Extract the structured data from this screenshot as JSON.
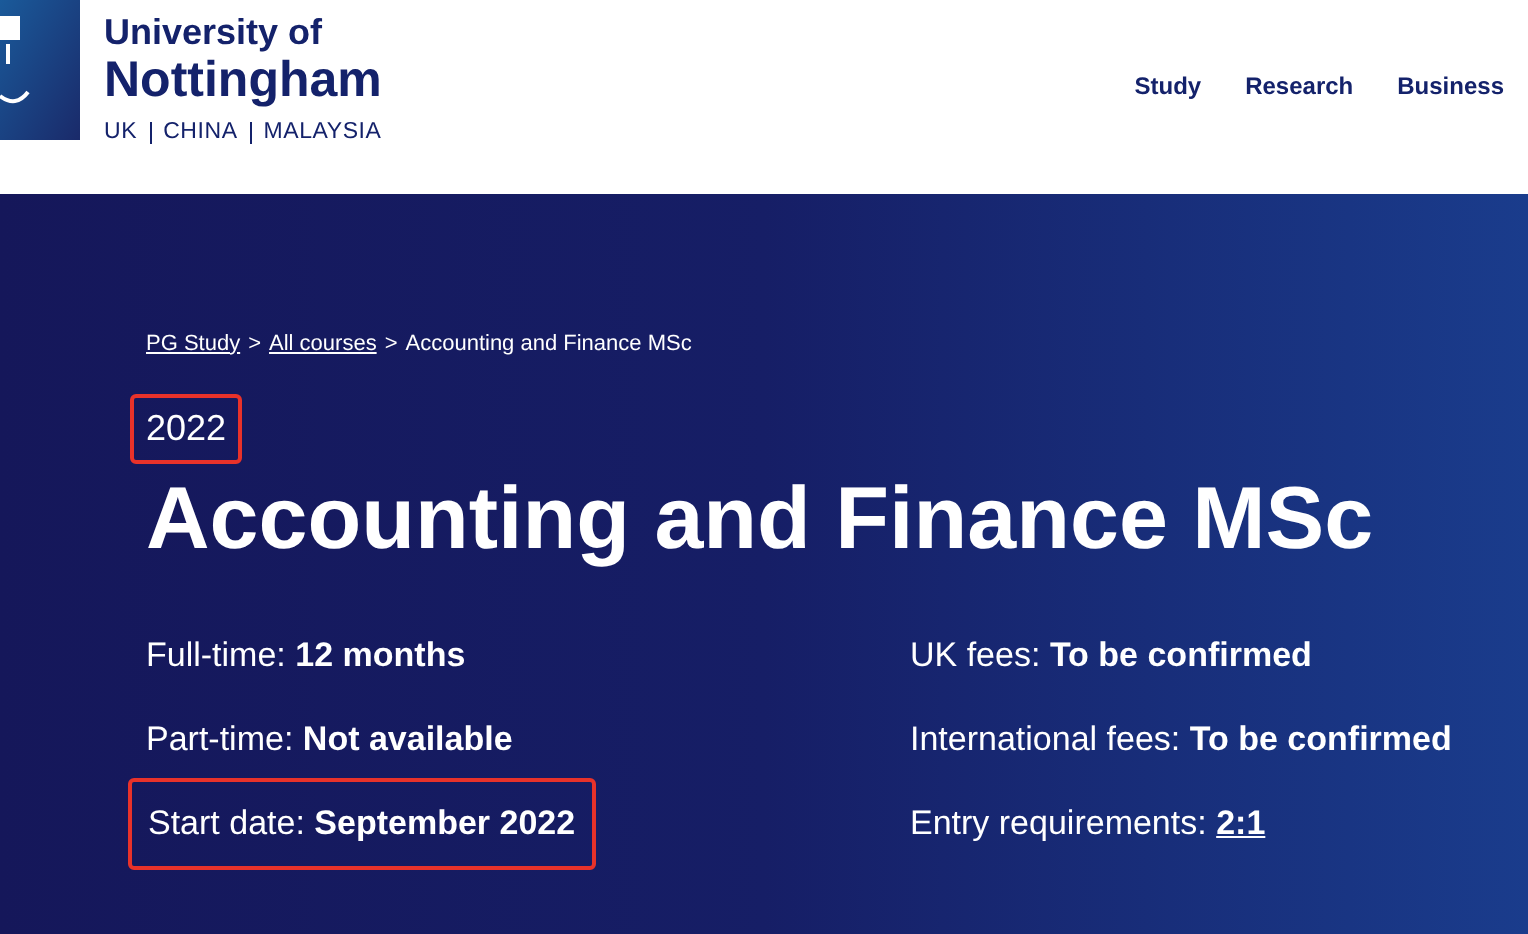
{
  "header": {
    "logo": {
      "line1": "University of",
      "line2": "Nottingham",
      "tagline": [
        "UK",
        "CHINA",
        "MALAYSIA"
      ]
    },
    "nav": [
      "Study",
      "Research",
      "Business"
    ]
  },
  "hero": {
    "breadcrumb": {
      "separator": ">",
      "items": [
        {
          "label": "PG Study",
          "link": true
        },
        {
          "label": "All courses",
          "link": true
        },
        {
          "label": "Accounting and Finance MSc",
          "link": false
        }
      ]
    },
    "year": {
      "text": "2022",
      "highlighted": true
    },
    "title": "Accounting and Finance MSc",
    "facts_left": [
      {
        "label": "Full-time:",
        "value": "12 months",
        "link": false,
        "highlighted": false
      },
      {
        "label": "Part-time:",
        "value": "Not available",
        "link": false,
        "highlighted": false
      },
      {
        "label": "Start date:",
        "value": "September 2022",
        "link": false,
        "highlighted": true
      }
    ],
    "facts_right": [
      {
        "label": "UK fees:",
        "value": "To be confirmed",
        "link": false,
        "highlighted": false
      },
      {
        "label": "International fees:",
        "value": "To be confirmed",
        "link": false,
        "highlighted": false
      },
      {
        "label": "Entry requirements:",
        "value": "2:1",
        "link": true,
        "highlighted": false
      }
    ]
  }
}
